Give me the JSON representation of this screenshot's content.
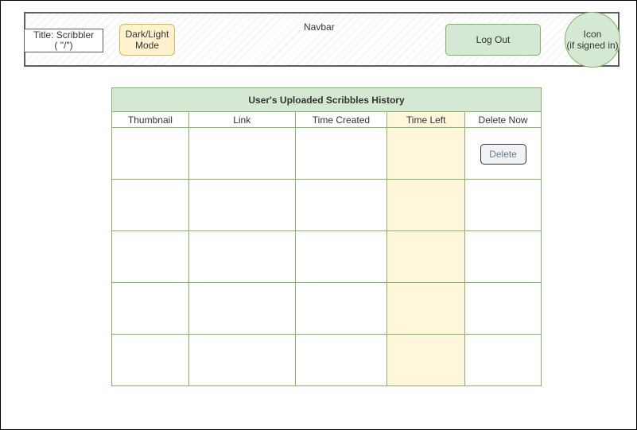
{
  "navbar": {
    "label": "Navbar",
    "title_line1": "Title: Scribbler",
    "title_line2": "( \"/\")",
    "mode_line1": "Dark/Light",
    "mode_line2": "Mode",
    "logout_label": "Log Out",
    "icon_line1": "Icon",
    "icon_line2": "(if signed in)"
  },
  "history": {
    "title": "User's Uploaded Scribbles History",
    "columns": [
      "Thumbnail",
      "Link",
      "Time Created",
      "Time Left",
      "Delete Now"
    ],
    "delete_label": "Delete"
  },
  "colors": {
    "green_fill": "#d5e8d4",
    "green_stroke": "#82b366",
    "yellow_fill": "#fff2cc",
    "yellow_stroke": "#d6b656",
    "time_left_fill": "#fff6dc"
  }
}
